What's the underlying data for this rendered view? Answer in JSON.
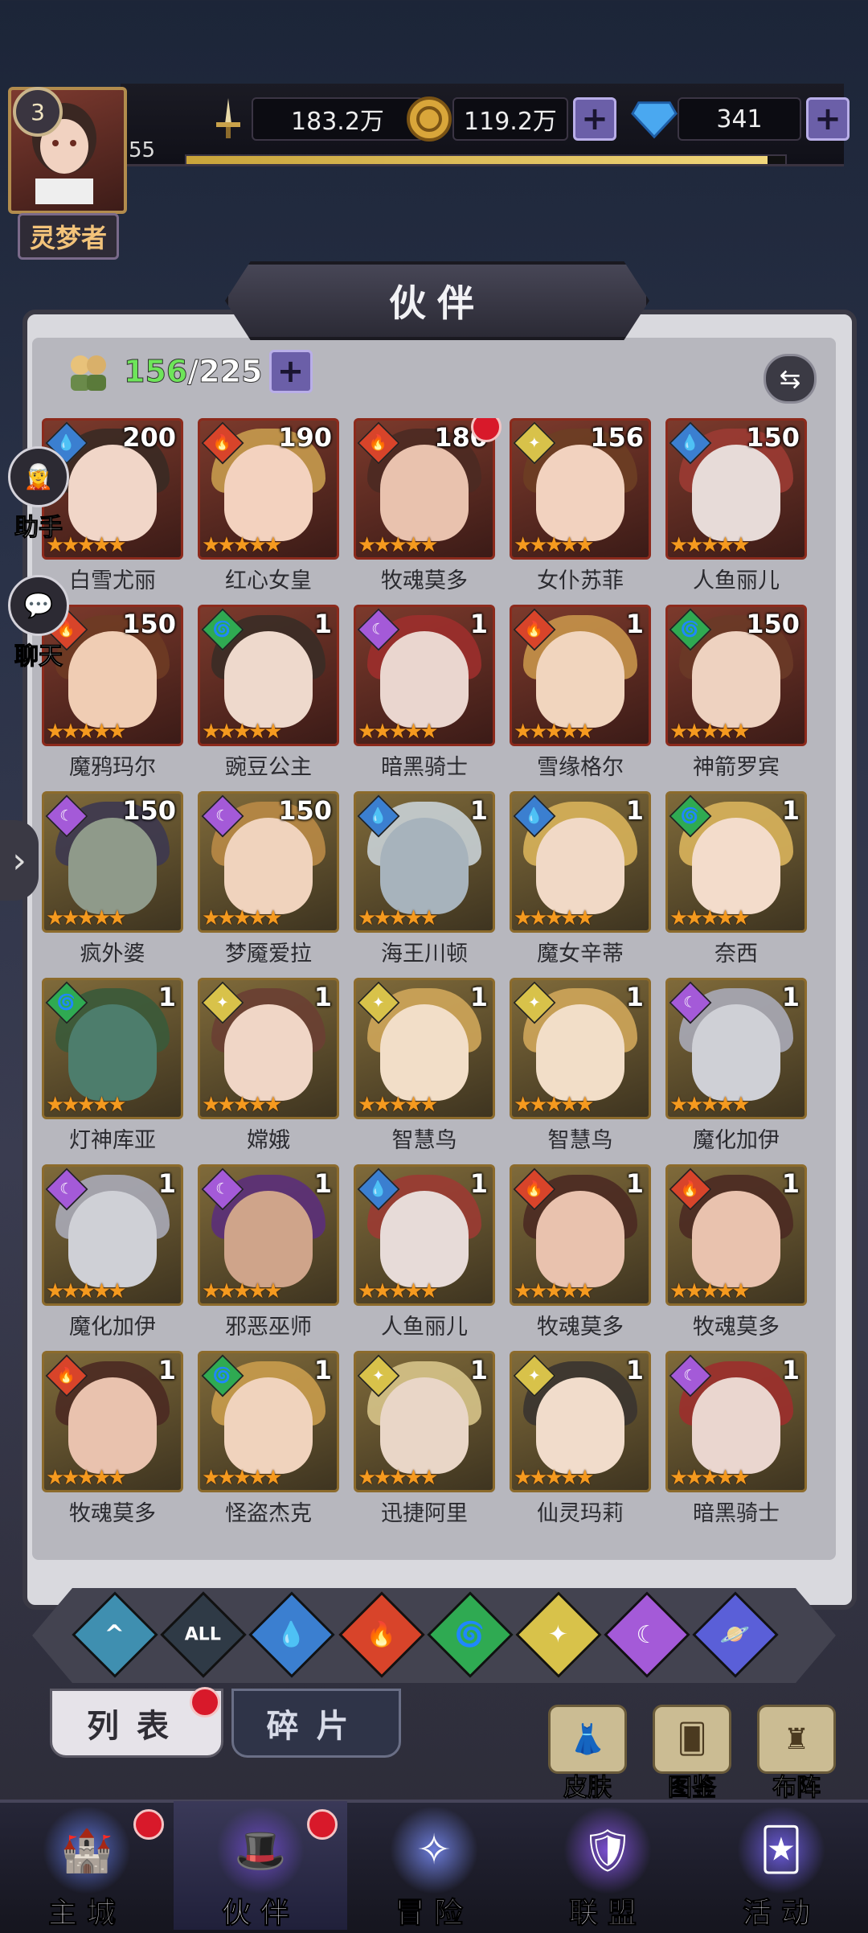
{
  "header": {
    "level": "3",
    "vip": "55",
    "title_plate": "灵梦者",
    "xp_fraction": 0.97,
    "resources": [
      {
        "name": "power",
        "icon": "sword-icon",
        "value": "183.2万",
        "plus": false
      },
      {
        "name": "gold",
        "icon": "gold-coin-icon",
        "value": "119.2万",
        "plus": true
      },
      {
        "name": "diamond",
        "icon": "diamond-icon",
        "value": "341",
        "plus": true
      }
    ]
  },
  "panel": {
    "title": "伙伴",
    "count_current": "156",
    "count_total": "/225"
  },
  "side": {
    "assistant": "助手",
    "chat": "聊天"
  },
  "colors": {
    "water": "#3b7fd0",
    "fire": "#d8442a",
    "wind": "#2faa52",
    "light": "#d8c24a",
    "dark": "#a45ad8",
    "cosmic": "#5a5fd8"
  },
  "heroes": [
    {
      "name": "白雪尤丽",
      "level": "200",
      "element": "water",
      "stars": 5,
      "frame": "red",
      "skin": "#f1d6c8",
      "hair": "#3a2a24"
    },
    {
      "name": "红心女皇",
      "level": "190",
      "element": "fire",
      "stars": 5,
      "frame": "red",
      "skin": "#f3d2bf",
      "hair": "#c79b4e"
    },
    {
      "name": "牧魂莫多",
      "level": "180",
      "element": "fire",
      "stars": 5,
      "frame": "red",
      "skin": "#e9c2ae",
      "hair": "#4b2a22",
      "dot": true
    },
    {
      "name": "女仆苏菲",
      "level": "156",
      "element": "light",
      "stars": 5,
      "frame": "red",
      "skin": "#f2d2bf",
      "hair": "#6d3e24"
    },
    {
      "name": "人鱼丽儿",
      "level": "150",
      "element": "water",
      "stars": 5,
      "frame": "red",
      "skin": "#e7dbd8",
      "hair": "#9b3b33"
    },
    {
      "name": "魔鸦玛尔",
      "level": "150",
      "element": "fire",
      "stars": 5,
      "frame": "red",
      "skin": "#f0cdb4",
      "hair": "#6e3b24"
    },
    {
      "name": "豌豆公主",
      "level": "1",
      "element": "wind",
      "stars": 5,
      "frame": "red",
      "skin": "#eed9cc",
      "hair": "#3a2c26"
    },
    {
      "name": "暗黑骑士",
      "level": "1",
      "element": "dark",
      "stars": 5,
      "frame": "red",
      "skin": "#ead6cf",
      "hair": "#9c2f2c"
    },
    {
      "name": "雪缘格尔",
      "level": "1",
      "element": "fire",
      "stars": 5,
      "frame": "red",
      "skin": "#f1d5be",
      "hair": "#c7944a"
    },
    {
      "name": "神箭罗宾",
      "level": "150",
      "element": "wind",
      "stars": 5,
      "frame": "red",
      "skin": "#eed2c0",
      "hair": "#6a3a27"
    },
    {
      "name": "疯外婆",
      "level": "150",
      "element": "dark",
      "stars": 5,
      "frame": "gold",
      "skin": "#8f9a8a",
      "hair": "#3d3850"
    },
    {
      "name": "梦魇爱拉",
      "level": "150",
      "element": "dark",
      "stars": 5,
      "frame": "gold",
      "skin": "#f0d3bd",
      "hair": "#b98a46"
    },
    {
      "name": "海王川顿",
      "level": "1",
      "element": "water",
      "stars": 5,
      "frame": "gold",
      "skin": "#a7b3bc",
      "hair": "#c9d2d6"
    },
    {
      "name": "魔女辛蒂",
      "level": "1",
      "element": "water",
      "stars": 5,
      "frame": "gold",
      "skin": "#f1d9c6",
      "hair": "#d8b25a"
    },
    {
      "name": "奈西",
      "level": "1",
      "element": "wind",
      "stars": 5,
      "frame": "gold",
      "skin": "#f3dccb",
      "hair": "#d9b45c"
    },
    {
      "name": "灯神库亚",
      "level": "1",
      "element": "wind",
      "stars": 5,
      "frame": "gold",
      "skin": "#4d7d6c",
      "hair": "#3a5a3a"
    },
    {
      "name": "嫦娥",
      "level": "1",
      "element": "light",
      "stars": 5,
      "frame": "gold",
      "skin": "#f0d6c6",
      "hair": "#6a3f33"
    },
    {
      "name": "智慧鸟",
      "level": "1",
      "element": "light",
      "stars": 5,
      "frame": "gold",
      "skin": "#f2dec8",
      "hair": "#cfa65a"
    },
    {
      "name": "智慧鸟",
      "level": "1",
      "element": "light",
      "stars": 5,
      "frame": "gold",
      "skin": "#f2dec8",
      "hair": "#cfa65a"
    },
    {
      "name": "魔化加伊",
      "level": "1",
      "element": "dark",
      "stars": 5,
      "frame": "gold",
      "skin": "#cfd0d6",
      "hair": "#a8aab7"
    },
    {
      "name": "魔化加伊",
      "level": "1",
      "element": "dark",
      "stars": 5,
      "frame": "gold",
      "skin": "#cfd0d6",
      "hair": "#a8aab7"
    },
    {
      "name": "邪恶巫师",
      "level": "1",
      "element": "dark",
      "stars": 5,
      "frame": "gold",
      "skin": "#cfa48a",
      "hair": "#5b2f7a"
    },
    {
      "name": "人鱼丽儿",
      "level": "1",
      "element": "water",
      "stars": 5,
      "frame": "gold",
      "skin": "#e7dbd8",
      "hair": "#9b3b33"
    },
    {
      "name": "牧魂莫多",
      "level": "1",
      "element": "fire",
      "stars": 5,
      "frame": "gold",
      "skin": "#e9c2ae",
      "hair": "#4b2a22"
    },
    {
      "name": "牧魂莫多",
      "level": "1",
      "element": "fire",
      "stars": 5,
      "frame": "gold",
      "skin": "#e9c2ae",
      "hair": "#4b2a22"
    },
    {
      "name": "牧魂莫多",
      "level": "1",
      "element": "fire",
      "stars": 5,
      "frame": "gold",
      "skin": "#e9c2ae",
      "hair": "#4b2a22"
    },
    {
      "name": "怪盗杰克",
      "level": "1",
      "element": "wind",
      "stars": 5,
      "frame": "gold",
      "skin": "#f0d3bd",
      "hair": "#c99c4d"
    },
    {
      "name": "迅捷阿里",
      "level": "1",
      "element": "light",
      "stars": 5,
      "frame": "gold",
      "skin": "#e9d6c7",
      "hair": "#d7c48a"
    },
    {
      "name": "仙灵玛莉",
      "level": "1",
      "element": "light",
      "stars": 5,
      "frame": "gold",
      "skin": "#f1dccb",
      "hair": "#3a3430"
    },
    {
      "name": "暗黑骑士",
      "level": "1",
      "element": "dark",
      "stars": 5,
      "frame": "gold",
      "skin": "#ead6cf",
      "hair": "#9c2f2c"
    }
  ],
  "filters": [
    {
      "key": "arrow",
      "icon": "chevron-up-icon",
      "color": "#3f8fb0",
      "label": "^"
    },
    {
      "key": "all",
      "icon": "all-icon",
      "color": "#2f3a46",
      "label": "ALL"
    },
    {
      "key": "water",
      "icon": "water-drop-icon",
      "color": "#3b7fd0",
      "label": "💧"
    },
    {
      "key": "fire",
      "icon": "fire-icon",
      "color": "#d8442a",
      "label": "🔥"
    },
    {
      "key": "wind",
      "icon": "wind-icon",
      "color": "#2faa52",
      "label": "🌀"
    },
    {
      "key": "light",
      "icon": "light-icon",
      "color": "#d8c24a",
      "label": "✦"
    },
    {
      "key": "dark",
      "icon": "moon-icon",
      "color": "#a45ad8",
      "label": "☾"
    },
    {
      "key": "cosmic",
      "icon": "planet-icon",
      "color": "#5a5fd8",
      "label": "🪐"
    }
  ],
  "tabs": {
    "list": "列表",
    "fragments": "碎片"
  },
  "quick": [
    {
      "label": "皮肤",
      "icon": "skin-icon",
      "glyph": "👗"
    },
    {
      "label": "图鉴",
      "icon": "codex-icon",
      "glyph": "🂠"
    },
    {
      "label": "布阵",
      "icon": "formation-icon",
      "glyph": "♜"
    }
  ],
  "nav": [
    {
      "label": "主城",
      "icon": "castle-icon",
      "glyph": "🏰",
      "badge": true,
      "active": false
    },
    {
      "label": "伙伴",
      "icon": "witch-hat-icon",
      "glyph": "🎩",
      "badge": true,
      "active": true
    },
    {
      "label": "冒险",
      "icon": "compass-icon",
      "glyph": "✧",
      "badge": false,
      "active": false
    },
    {
      "label": "联盟",
      "icon": "shield-icon",
      "glyph": "🛡",
      "badge": false,
      "active": false
    },
    {
      "label": "活动",
      "icon": "cards-icon",
      "glyph": "🃏",
      "badge": false,
      "active": false
    }
  ]
}
